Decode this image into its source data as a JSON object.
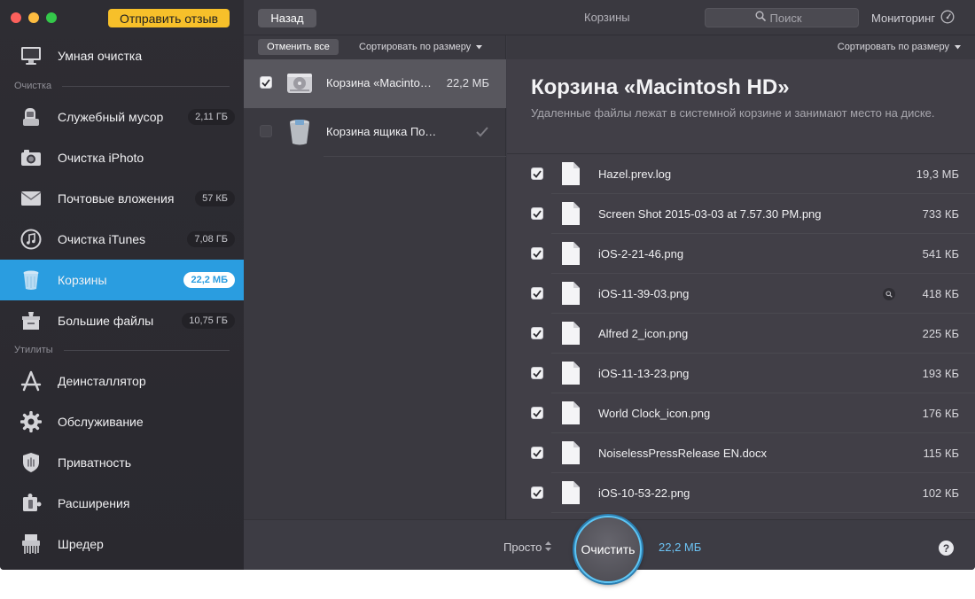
{
  "sidebar": {
    "feedback_button": "Отправить отзыв",
    "smart_clean": {
      "label": "Умная очистка",
      "icon": "monitor-icon"
    },
    "section_cleanup": "Очистка",
    "section_utilities": "Утилиты",
    "items": [
      {
        "label": "Служебный мусор",
        "badge": "2,11 ГБ",
        "icon": "system-junk-icon"
      },
      {
        "label": "Очистка iPhoto",
        "badge": "",
        "icon": "camera-icon"
      },
      {
        "label": "Почтовые вложения",
        "badge": "57 КБ",
        "icon": "mail-icon"
      },
      {
        "label": "Очистка iTunes",
        "badge": "7,08 ГБ",
        "icon": "music-note-icon"
      },
      {
        "label": "Корзины",
        "badge": "22,2 МБ",
        "icon": "trash-icon",
        "active": true
      },
      {
        "label": "Большие файлы",
        "badge": "10,75 ГБ",
        "icon": "large-files-icon"
      }
    ],
    "utilities": [
      {
        "label": "Деинсталлятор",
        "icon": "app-store-icon"
      },
      {
        "label": "Обслуживание",
        "icon": "gear-icon"
      },
      {
        "label": "Приватность",
        "icon": "hand-shield-icon"
      },
      {
        "label": "Расширения",
        "icon": "puzzle-icon"
      },
      {
        "label": "Шредер",
        "icon": "shredder-icon"
      }
    ]
  },
  "topbar": {
    "back_label": "Назад",
    "title": "Корзины",
    "search_placeholder": "Поиск",
    "monitor_label": "Мониторинг"
  },
  "middle": {
    "deselect_label": "Отменить все",
    "sort_label": "Сортировать по размеру",
    "bins": [
      {
        "name": "Корзина «Macintosh HD»",
        "size": "22,2 МБ",
        "checked": true,
        "selected": true
      },
      {
        "name": "Корзина ящика Почты",
        "size": "",
        "checked": false,
        "selected": false
      }
    ]
  },
  "detail": {
    "sort_label": "Сортировать по размеру",
    "title": "Корзина «Macintosh HD»",
    "description": "Удаленные файлы лежат в системной корзине и занимают место на диске.",
    "files": [
      {
        "name": "Hazel.prev.log",
        "size": "19,3 МБ",
        "checked": true
      },
      {
        "name": "Screen Shot 2015-03-03 at 7.57.30 PM.png",
        "size": "733 КБ",
        "checked": true
      },
      {
        "name": "iOS-2-21-46.png",
        "size": "541 КБ",
        "checked": true
      },
      {
        "name": "iOS-11-39-03.png",
        "size": "418 КБ",
        "checked": true,
        "quicklook": true
      },
      {
        "name": "Alfred 2_icon.png",
        "size": "225 КБ",
        "checked": true
      },
      {
        "name": "iOS-11-13-23.png",
        "size": "193 КБ",
        "checked": true
      },
      {
        "name": "World Clock_icon.png",
        "size": "176 КБ",
        "checked": true
      },
      {
        "name": "NoiselessPressRelease EN.docx",
        "size": "115 КБ",
        "checked": true
      },
      {
        "name": "iOS-10-53-22.png",
        "size": "102 КБ",
        "checked": true
      }
    ]
  },
  "bottombar": {
    "mode_label": "Просто",
    "clean_label": "Очистить",
    "total_size": "22,2 МБ",
    "help_label": "?"
  },
  "colors": {
    "accent": "#2a9de0",
    "feedback": "#f7c02a",
    "total_size": "#6cc3f4",
    "sidebar_bg": "#2c2b31"
  }
}
